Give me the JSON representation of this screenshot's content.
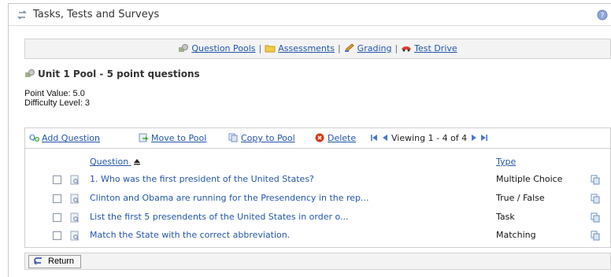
{
  "header": {
    "title": "Tasks, Tests and Surveys"
  },
  "nav": {
    "items": [
      {
        "label": "Question Pools",
        "icon": "question-pools-icon"
      },
      {
        "label": "Assessments",
        "icon": "folder-icon"
      },
      {
        "label": "Grading",
        "icon": "pencil-icon"
      },
      {
        "label": "Test Drive",
        "icon": "car-icon"
      }
    ],
    "separator": "|"
  },
  "pool": {
    "title": "Unit 1 Pool - 5 point questions",
    "point_value": "Point Value: 5.0",
    "difficulty": "Difficulty Level: 3"
  },
  "toolbar": {
    "add_question": "Add Question",
    "move_to_pool": "Move to Pool",
    "copy_to_pool": "Copy to Pool",
    "delete": "Delete",
    "viewing": "Viewing 1 - 4 of 4"
  },
  "table": {
    "columns": [
      "Question",
      "Type"
    ],
    "rows": [
      {
        "question": "1. Who was the first president of the United States?",
        "type": "Multiple Choice"
      },
      {
        "question": "Clinton and Obama are running for the Presendency in the rep...",
        "type": "True / False"
      },
      {
        "question": "List the first 5 presendents of the United States in order o...",
        "type": "Task"
      },
      {
        "question": "Match the State with the correct abbreviation.",
        "type": "Matching"
      }
    ]
  },
  "footer": {
    "return_label": "Return"
  },
  "colors": {
    "link": "#2255aa",
    "delete_red": "#d83a1a"
  }
}
